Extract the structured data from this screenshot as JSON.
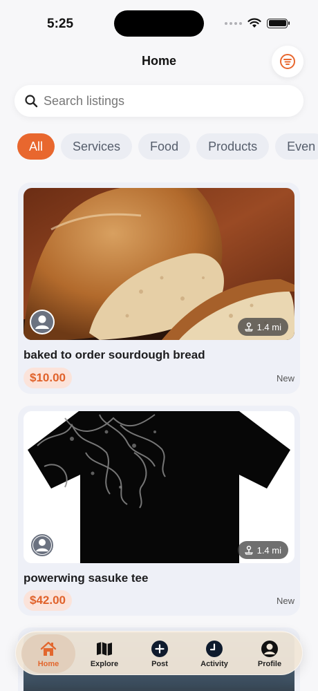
{
  "status_bar": {
    "time": "5:25"
  },
  "header": {
    "title": "Home",
    "filter_icon": "filter-lines-icon"
  },
  "search": {
    "placeholder": "Search listings",
    "value": ""
  },
  "categories": [
    {
      "label": "All",
      "active": true
    },
    {
      "label": "Services",
      "active": false
    },
    {
      "label": "Food",
      "active": false
    },
    {
      "label": "Products",
      "active": false
    },
    {
      "label": "Even",
      "active": false
    }
  ],
  "listings": [
    {
      "title": "baked to order sourdough bread",
      "price": "$10.00",
      "distance": "1.4 mi",
      "condition": "New",
      "image": "sourdough-bread-photo"
    },
    {
      "title": "powerwing sasuke tee",
      "price": "$42.00",
      "distance": "1.4 mi",
      "condition": "New",
      "image": "black-graphic-tee-photo"
    }
  ],
  "tab_bar": [
    {
      "label": "Home",
      "icon": "house-icon",
      "active": true
    },
    {
      "label": "Explore",
      "icon": "map-icon",
      "active": false
    },
    {
      "label": "Post",
      "icon": "plus-circle-icon",
      "active": false
    },
    {
      "label": "Activity",
      "icon": "clock-icon",
      "active": false
    },
    {
      "label": "Profile",
      "icon": "person-icon",
      "active": false
    }
  ],
  "colors": {
    "accent": "#e8672e",
    "chip_bg": "#ebedf3",
    "card_bg": "#eef0f7",
    "price_bg": "#fbe3da"
  }
}
